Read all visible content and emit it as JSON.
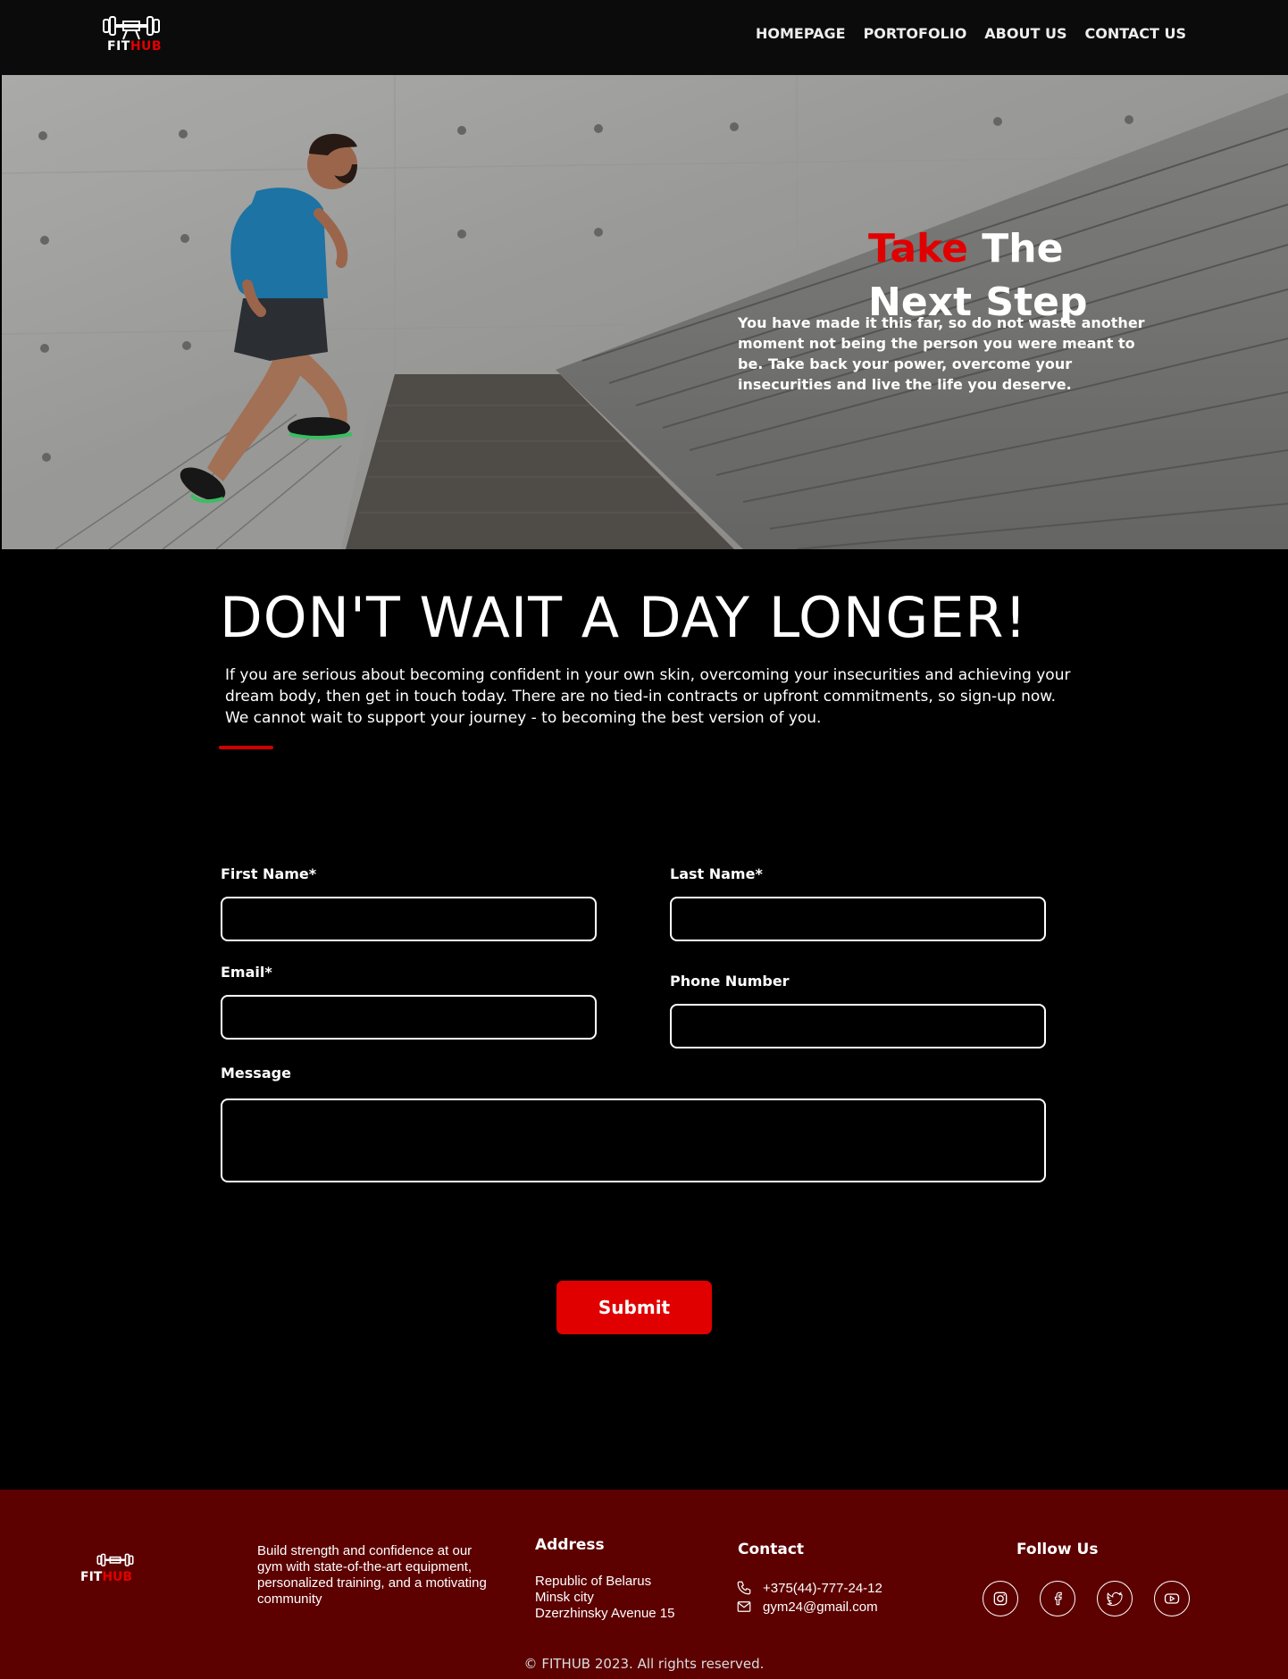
{
  "nav": {
    "logo": {
      "fit": "FIT",
      "hub": "HUB"
    },
    "links": [
      "HOMEPAGE",
      "PORTOFOLIO",
      "ABOUT US",
      "CONTACT US"
    ]
  },
  "hero": {
    "title_red": "Take",
    "title_rest": " The Next Step",
    "text": "You have made it this far, so do not waste another moment not being the person you were meant to be. Take back your power, overcome your insecurities and live the life you deserve."
  },
  "main": {
    "title": "DON'T WAIT A DAY LONGER!",
    "text": "If you are serious about becoming confident in your own skin, overcoming your insecurities and achieving your dream body, then get in touch today. There are no tied-in contracts or upfront commitments, so sign-up now. We cannot wait to support your journey - to becoming the best version of you."
  },
  "form": {
    "first_name_label": "First Name*",
    "last_name_label": "Last Name*",
    "email_label": "Email*",
    "phone_label": "Phone Number",
    "message_label": "Message",
    "first_name_value": "",
    "last_name_value": "",
    "email_value": "",
    "phone_value": "",
    "message_value": "",
    "submit_label": "Submit"
  },
  "footer": {
    "logo": {
      "fit": "FIT",
      "hub": "HUB"
    },
    "description": "Build strength and confidence at our gym with state-of-the-art equipment, personalized training, and a motivating community",
    "address_heading": "Address",
    "address_lines": [
      "Republic of Belarus",
      "Minsk city",
      "Dzerzhinsky Avenue 15"
    ],
    "contact_heading": "Contact",
    "phone": "+375(44)-777-24-12",
    "email": "gym24@gmail.com",
    "follow_heading": "Follow Us",
    "socials": [
      "instagram-icon",
      "facebook-icon",
      "twitter-icon",
      "youtube-icon"
    ],
    "copyright": "FITHUB 2023. All rights reserved."
  },
  "colors": {
    "accent": "#e10000",
    "footer_bg": "#5c0000",
    "nav_bg": "#0b0b0b"
  }
}
